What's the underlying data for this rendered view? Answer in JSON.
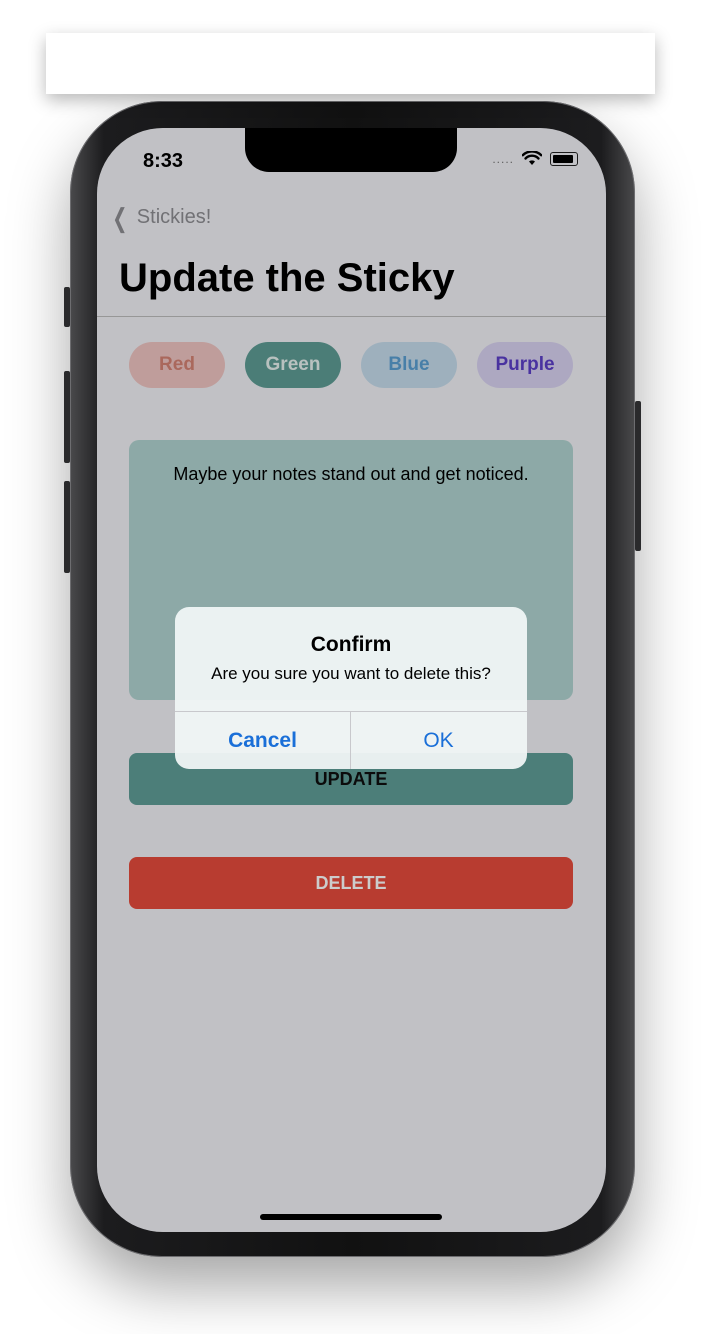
{
  "status_bar": {
    "time": "8:33",
    "signal": "....."
  },
  "nav": {
    "back_label": "Stickies!",
    "title": "Update the Sticky"
  },
  "color_options": [
    {
      "label": "Red",
      "color": "#e74c3c"
    },
    {
      "label": "Green",
      "color": "#2e8b7e"
    },
    {
      "label": "Blue",
      "color": "#5b9fd3"
    },
    {
      "label": "Purple",
      "color": "#5c3fc8"
    }
  ],
  "selected_color": "Green",
  "note": {
    "text": "Maybe your notes stand out and get noticed."
  },
  "buttons": {
    "update_label": "UPDATE",
    "delete_label": "DELETE"
  },
  "alert": {
    "title": "Confirm",
    "message": "Are you sure you want to delete this?",
    "cancel_label": "Cancel",
    "ok_label": "OK"
  }
}
